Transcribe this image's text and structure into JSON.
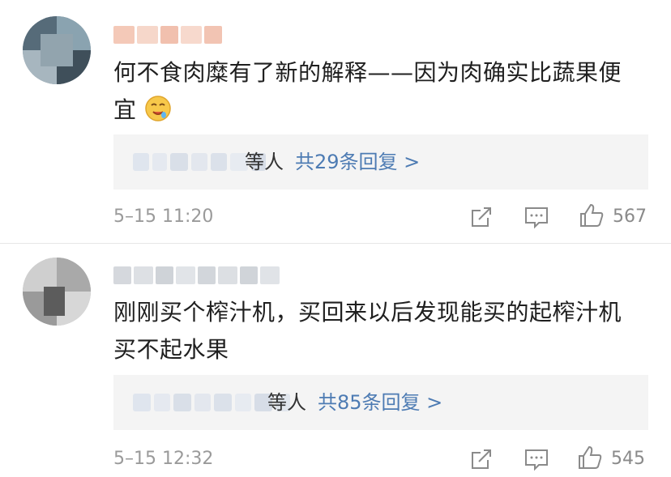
{
  "comments": [
    {
      "text_line1": "何不食肉糜有了新的解释——因为肉确实比蔬果便",
      "text_line2": "宜",
      "emoji": "drooling-face-emoji",
      "reply_who": "等人",
      "reply_count": "共29条回复 >",
      "time": "5–15 11:20",
      "likes": "567"
    },
    {
      "text_line1": "刚刚买个榨汁机，买回来以后发现能买的起榨汁机",
      "text_line2": "买不起水果",
      "reply_who": "等人",
      "reply_count": "共85条回复 >",
      "time": "5–15 12:32",
      "likes": "545"
    }
  ],
  "icons": [
    "share-icon",
    "comment-icon",
    "like-icon"
  ],
  "colors": {
    "link": "#4d7bb3",
    "muted": "#9a9a9a",
    "reply_bg": "#f4f4f4"
  }
}
